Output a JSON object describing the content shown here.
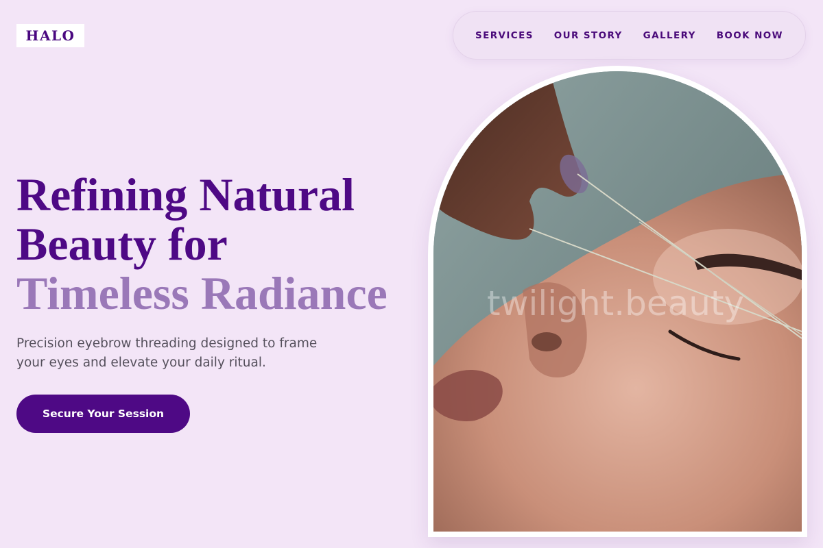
{
  "brand": {
    "logo": "HALO"
  },
  "nav": {
    "items": [
      {
        "label": "SERVICES"
      },
      {
        "label": "OUR STORY"
      },
      {
        "label": "GALLERY"
      },
      {
        "label": "BOOK NOW"
      }
    ]
  },
  "hero": {
    "headline_line1": "Refining Natural",
    "headline_line2": "Beauty for",
    "headline_line3": "Timeless Radiance",
    "subtext": "Precision eyebrow threading designed to frame your eyes and elevate your daily ritual.",
    "cta_label": "Secure Your Session",
    "image_watermark": "twilight.beauty"
  },
  "colors": {
    "background": "#f3e5f7",
    "primary": "#4e0985",
    "accent_light": "#9a78b8",
    "body_text": "#55505c"
  }
}
